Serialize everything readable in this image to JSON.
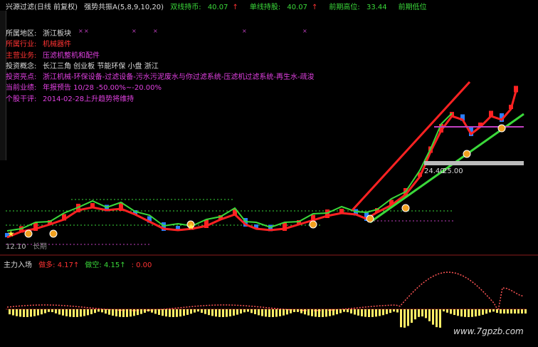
{
  "topbar": {
    "title": "兴源过滤(日线 前复权)",
    "indicator": "强势共振A(5,8,9,10,20)",
    "items": [
      {
        "label": "双线持币:",
        "value": "40.07",
        "arrow": "↑",
        "color": "#3ad93a",
        "arrow_color": "#ff3333"
      },
      {
        "label": "单线持股:",
        "value": "40.07",
        "arrow": "↑",
        "color": "#3ad93a",
        "arrow_color": "#ff3333"
      },
      {
        "label": "前期高位:",
        "value": "33.44",
        "arrow": "",
        "color": "#3ad93a"
      },
      {
        "label": "前期低位",
        "value": "",
        "arrow": "",
        "color": "#3ad93a"
      }
    ]
  },
  "info": [
    {
      "label": "所属地区:",
      "value": "浙江板块",
      "label_color": "#dddddd",
      "value_color": "#dddddd"
    },
    {
      "label": "所属行业:",
      "value": "机械器件",
      "label_color": "#ff3333",
      "value_color": "#ff3333"
    },
    {
      "label": "主营业务:",
      "value": "压滤机整机和配件",
      "label_color": "#ff3333",
      "value_color": "#e040e0"
    },
    {
      "label": "投资概念:",
      "value": "长江三角 创业板 节能环保 小盘 浙江",
      "label_color": "#dddddd",
      "value_color": "#dddddd"
    },
    {
      "label": "投资亮点:",
      "value": "浙江机械-环保设备-过滤设备-污水污泥废水与你过滤系统-压滤机过滤系统-再生水-疏浚",
      "label_color": "#e040e0",
      "value_color": "#e040e0"
    },
    {
      "label": "当前业绩:",
      "value": "年报预告 10/28 -50.00%~-20.00%",
      "label_color": "#e040e0",
      "value_color": "#e040e0"
    },
    {
      "label": "个股干评:",
      "value": "2014-02-28上升趋势将维持",
      "label_color": "#e040e0",
      "value_color": "#e040e0"
    }
  ],
  "chart_data": {
    "type": "line",
    "price_labels": [
      "24.40",
      "25.00"
    ],
    "low_label": "12.10",
    "note": "长期",
    "sub_title": "主力入场",
    "sub_items": [
      {
        "label": "做多:",
        "value": "4.17",
        "arrow": "↑",
        "color": "#ff3333"
      },
      {
        "label": "做空:",
        "value": "4.15",
        "arrow": "↑",
        "color": "#3ad93a"
      },
      {
        "label": "",
        "value": "0.00",
        "arrow": "",
        "color": "#ff3333"
      }
    ],
    "colors": {
      "up": "#ff2222",
      "down": "#3ad93a",
      "ma": "#ff2222",
      "trend_green": "#3ad93a",
      "hist": "#ffee66"
    }
  },
  "watermark": "www.7gpzb.com"
}
